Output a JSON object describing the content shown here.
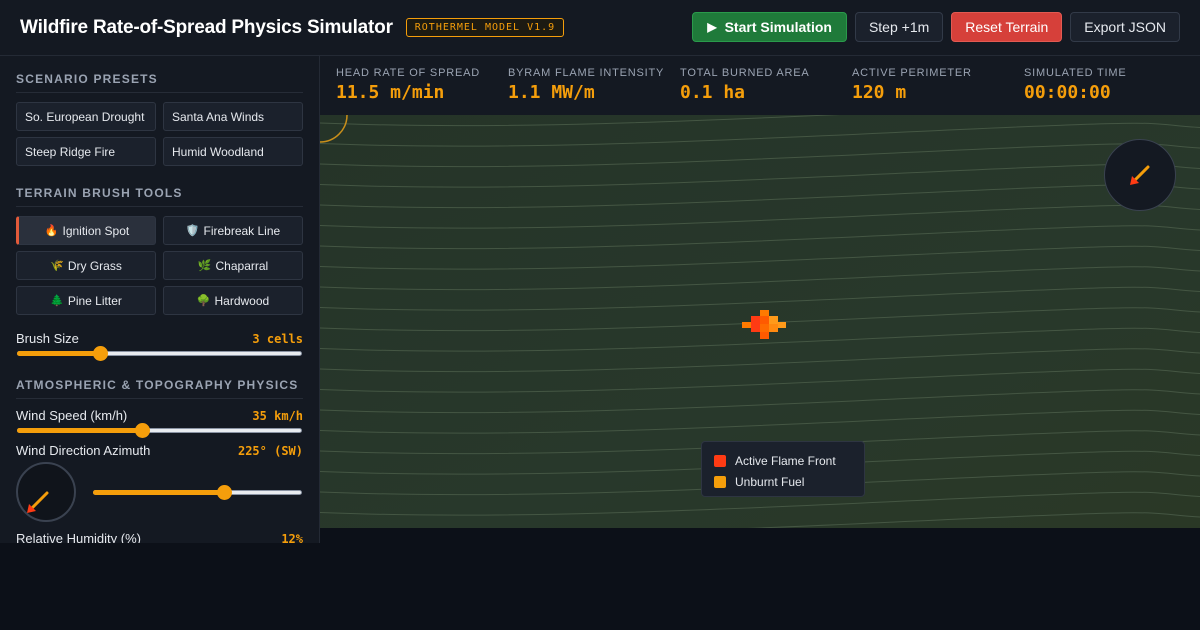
{
  "header": {
    "title": "Wildfire Rate-of-Spread Physics Simulator",
    "badge": "ROTHERMEL MODEL V1.9",
    "start_label": "Start Simulation",
    "step_label": "Step +1m",
    "reset_label": "Reset Terrain",
    "export_label": "Export JSON"
  },
  "sidebar": {
    "presets_title": "SCENARIO PRESETS",
    "presets": [
      "So. European Drought",
      "Santa Ana Winds",
      "Steep Ridge Fire",
      "Humid Woodland"
    ],
    "tools_title": "TERRAIN BRUSH TOOLS",
    "tools": [
      {
        "icon": "🔥",
        "label": "Ignition Spot",
        "active": true
      },
      {
        "icon": "🛡️",
        "label": "Firebreak Line",
        "active": false
      },
      {
        "icon": "🌾",
        "label": "Dry Grass",
        "active": false
      },
      {
        "icon": "🌿",
        "label": "Chaparral",
        "active": false
      },
      {
        "icon": "🌲",
        "label": "Pine Litter",
        "active": false
      },
      {
        "icon": "🌳",
        "label": "Hardwood",
        "active": false
      }
    ],
    "brush": {
      "label": "Brush Size",
      "value": "3 cells",
      "level": 0.29
    },
    "physics_title": "ATMOSPHERIC & TOPOGRAPHY PHYSICS",
    "wind_speed": {
      "label": "Wind Speed (km/h)",
      "value": "35 km/h",
      "level": 0.44
    },
    "wind_dir": {
      "label": "Wind Direction Azimuth",
      "value": "225° (SW)",
      "level": 0.625
    },
    "humidity": {
      "label": "Relative Humidity (%)",
      "value": "12%"
    }
  },
  "stats": [
    {
      "label": "HEAD RATE OF SPREAD",
      "value": "11.5 m/min"
    },
    {
      "label": "BYRAM FLAME INTENSITY",
      "value": "1.1 MW/m"
    },
    {
      "label": "TOTAL BURNED AREA",
      "value": "0.1 ha"
    },
    {
      "label": "ACTIVE PERIMETER",
      "value": "120 m"
    },
    {
      "label": "SIMULATED TIME",
      "value": "00:00:00"
    }
  ],
  "legend": [
    {
      "label": "Active Flame Front",
      "color": "#ff3b14"
    },
    {
      "label": "Unburnt Fuel",
      "color": "#f59e0b"
    }
  ],
  "colors": {
    "accent": "#f59e0b",
    "flame": "#ff3b14",
    "start": "#1f7a3a",
    "reset": "#d6403a"
  },
  "icons": {
    "start": "play-icon",
    "wind": "wind-arrow-icon"
  }
}
